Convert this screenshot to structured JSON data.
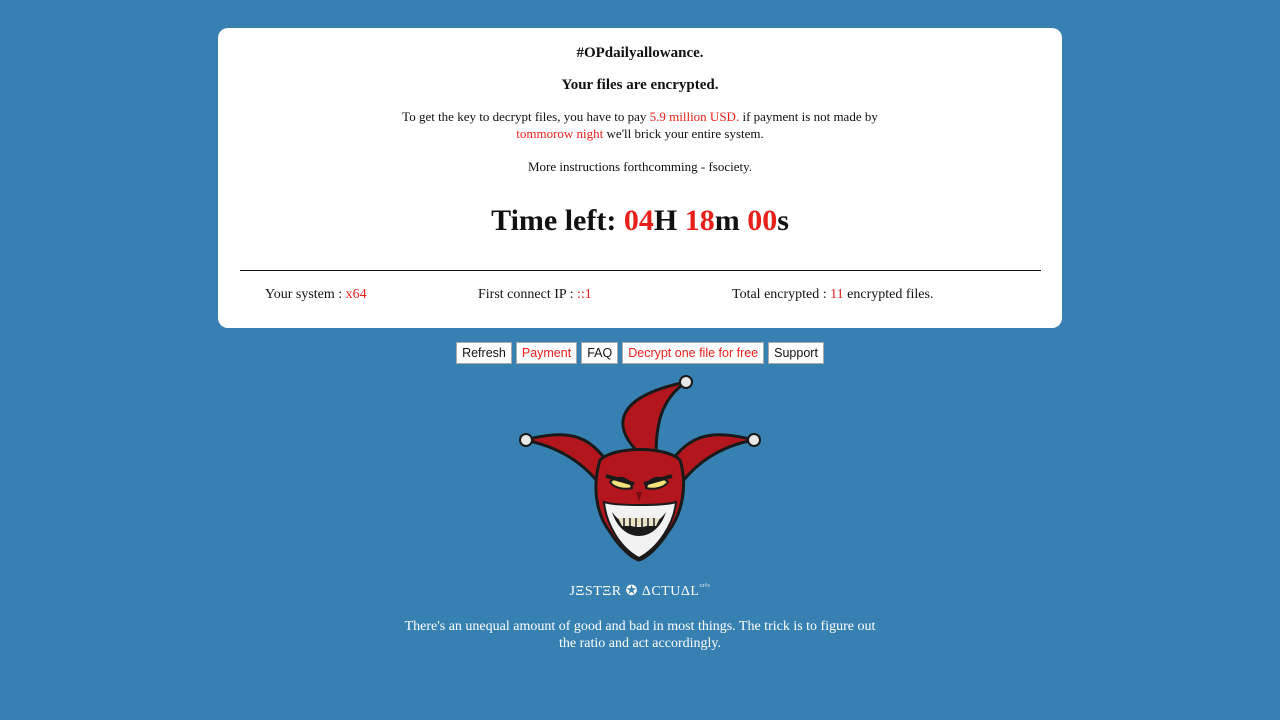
{
  "card": {
    "title": "#OPdailyallowance.",
    "subtitle": "Your files are encrypted.",
    "pay_text_1": "To get the key to decrypt files, you have to pay ",
    "pay_amount": "5.9 million USD.",
    "pay_text_2": " if payment is not made by ",
    "deadline": "tommorow night",
    "pay_text_3": " we'll brick your entire system.",
    "more": "More instructions forthcomming - fsociety.",
    "timer": {
      "label": "Time left: ",
      "hours": "04",
      "hours_unit": "H ",
      "minutes": "18",
      "minutes_unit": "m ",
      "seconds": "00",
      "seconds_unit": "s"
    },
    "system": {
      "label": "Your system : ",
      "value": "x64"
    },
    "ip": {
      "label": "First connect IP : ",
      "value": "::1"
    },
    "total": {
      "label": "Total encrypted : ",
      "value": "11",
      "suffix": " encrypted files."
    }
  },
  "buttons": {
    "refresh": "Refresh",
    "payment": "Payment",
    "faq": "FAQ",
    "decrypt_free": "Decrypt one file for free",
    "support": "Support"
  },
  "signature": {
    "name": "JΞSTΞR ✪ ΔCTUΔL",
    "sup": "³³⁰¹"
  },
  "quote": "There's an unequal amount of good and bad in most things. The trick is to figure out the ratio and act accordingly.",
  "colors": {
    "background": "#3781b2",
    "accent_red": "#e8201b",
    "card": "#ffffff"
  },
  "icons": {
    "mascot": "jester-face-icon"
  }
}
